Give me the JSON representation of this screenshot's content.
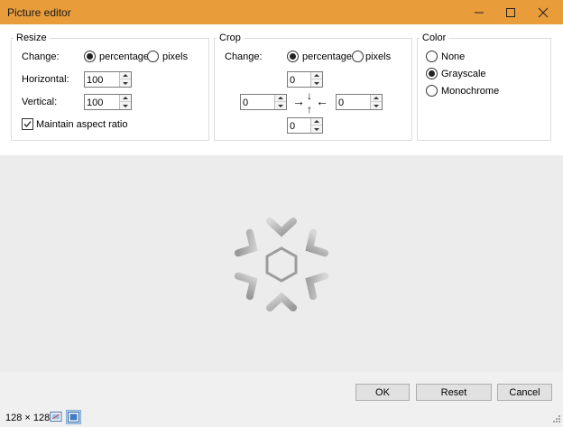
{
  "window": {
    "title": "Picture editor",
    "controls": {
      "minimize_icon": "minimize-icon",
      "maximize_icon": "maximize-icon",
      "close_icon": "close-icon"
    }
  },
  "resize": {
    "group_label": "Resize",
    "change_label": "Change:",
    "options": [
      {
        "label": "percentage",
        "checked": true
      },
      {
        "label": "pixels",
        "checked": false
      }
    ],
    "horizontal_label": "Horizontal:",
    "horizontal_value": "100",
    "vertical_label": "Vertical:",
    "vertical_value": "100",
    "maintain_label": "Maintain aspect ratio",
    "maintain_checked": true
  },
  "crop": {
    "group_label": "Crop",
    "change_label": "Change:",
    "options": [
      {
        "label": "percentage",
        "checked": true
      },
      {
        "label": "pixels",
        "checked": false
      }
    ],
    "top_value": "0",
    "left_value": "0",
    "right_value": "0",
    "bottom_value": "0",
    "arrow_right": "→",
    "arrow_left": "←",
    "arrow_down": "↓",
    "arrow_up": "↑"
  },
  "color": {
    "group_label": "Color",
    "options": [
      {
        "label": "None",
        "checked": false
      },
      {
        "label": "Grayscale",
        "checked": true
      },
      {
        "label": "Monochrome",
        "checked": false
      }
    ]
  },
  "preview": {
    "image_icon": "snowflake-icon"
  },
  "buttons": {
    "ok": "OK",
    "reset": "Reset",
    "cancel": "Cancel"
  },
  "status": {
    "dimensions": "128 × 128",
    "fit_icon": "fit-to-window-icon",
    "actual_size_icon": "actual-size-icon"
  }
}
